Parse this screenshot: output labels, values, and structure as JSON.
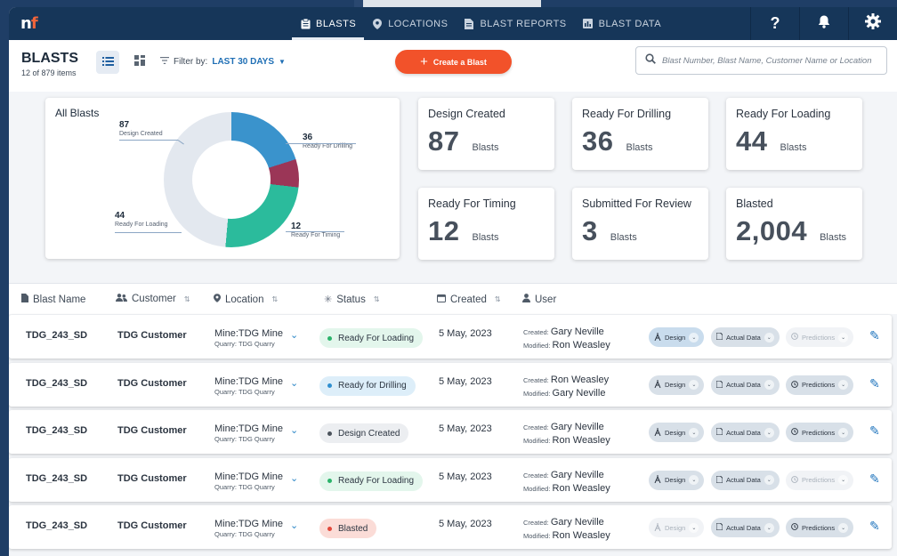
{
  "nav": {
    "items": [
      {
        "label": "BLASTS",
        "icon": "clipboard-icon",
        "active": true
      },
      {
        "label": "LOCATIONS",
        "icon": "location-pin-icon",
        "active": false
      },
      {
        "label": "BLAST REPORTS",
        "icon": "document-icon",
        "active": false
      },
      {
        "label": "BLAST DATA",
        "icon": "bar-chart-icon",
        "active": false
      }
    ],
    "help_label": "?"
  },
  "header": {
    "title": "BLASTS",
    "count": "12 of 879 items",
    "filter_prefix": "Filter by:",
    "filter_value": "LAST 30 DAYS",
    "create_label": "Create a Blast",
    "search_placeholder": "Blast Number, Blast Name, Customer Name or Location"
  },
  "donut": {
    "title": "All Blasts",
    "segments": [
      {
        "label": "Ready For Drilling",
        "value": "36",
        "color": "#3a93cc"
      },
      {
        "label": "Ready For Timing",
        "value": "12",
        "color": "#9b3657"
      },
      {
        "label": "Ready For Loading",
        "value": "44",
        "color": "#2bbb9c"
      },
      {
        "label": "Design Created",
        "value": "87",
        "color": "#e3e8ef"
      }
    ]
  },
  "stats": [
    {
      "label": "Design Created",
      "value": "87",
      "unit": "Blasts"
    },
    {
      "label": "Ready For Drilling",
      "value": "36",
      "unit": "Blasts"
    },
    {
      "label": "Ready For Loading",
      "value": "44",
      "unit": "Blasts"
    },
    {
      "label": "Ready For Timing",
      "value": "12",
      "unit": "Blasts"
    },
    {
      "label": "Submitted For Review",
      "value": "3",
      "unit": "Blasts"
    },
    {
      "label": "Blasted",
      "value": "2,004",
      "unit": "Blasts"
    }
  ],
  "table": {
    "columns": {
      "name": "Blast Name",
      "customer": "Customer",
      "location": "Location",
      "status": "Status",
      "created": "Created",
      "user": "User"
    },
    "created_prefix": "Created:",
    "modified_prefix": "Modified:",
    "action_labels": {
      "design": "Design",
      "actual": "Actual Data",
      "predictions": "Predictions"
    },
    "rows": [
      {
        "name": "TDG_243_SD",
        "customer": "TDG Customer",
        "mine": "Mine:TDG Mine",
        "quarry": "Quarry: TDG Quarry",
        "status": "Ready For Loading",
        "status_bg": "#e3f6ec",
        "status_dot": "#2bb36a",
        "date": "5 May, 2023",
        "created_by": "Gary Neville",
        "modified_by": "Ron Weasley",
        "design": "sel",
        "actual": "on",
        "predictions": "off"
      },
      {
        "name": "TDG_243_SD",
        "customer": "TDG Customer",
        "mine": "Mine:TDG Mine",
        "quarry": "Quarry: TDG Quarry",
        "status": "Ready for Drilling",
        "status_bg": "#ddeef9",
        "status_dot": "#2f8fd0",
        "date": "5 May, 2023",
        "created_by": "Ron Weasley",
        "modified_by": "Gary Neville",
        "design": "on",
        "actual": "on",
        "predictions": "on"
      },
      {
        "name": "TDG_243_SD",
        "customer": "TDG Customer",
        "mine": "Mine:TDG Mine",
        "quarry": "Quarry: TDG Quarry",
        "status": "Design Created",
        "status_bg": "#eceef1",
        "status_dot": "#4b535c",
        "date": "5 May, 2023",
        "created_by": "Gary Neville",
        "modified_by": "Ron Weasley",
        "design": "on",
        "actual": "on",
        "predictions": "on"
      },
      {
        "name": "TDG_243_SD",
        "customer": "TDG Customer",
        "mine": "Mine:TDG Mine",
        "quarry": "Quarry: TDG Quarry",
        "status": "Ready For Loading",
        "status_bg": "#e3f6ec",
        "status_dot": "#2bb36a",
        "date": "5 May, 2023",
        "created_by": "Gary Neville",
        "modified_by": "Ron Weasley",
        "design": "on",
        "actual": "on",
        "predictions": "off"
      },
      {
        "name": "TDG_243_SD",
        "customer": "TDG Customer",
        "mine": "Mine:TDG Mine",
        "quarry": "Quarry: TDG Quarry",
        "status": "Blasted",
        "status_bg": "#fbdcd7",
        "status_dot": "#e2483a",
        "date": "5 May, 2023",
        "created_by": "Gary Neville",
        "modified_by": "Ron Weasley",
        "design": "off",
        "actual": "on",
        "predictions": "on"
      }
    ]
  }
}
